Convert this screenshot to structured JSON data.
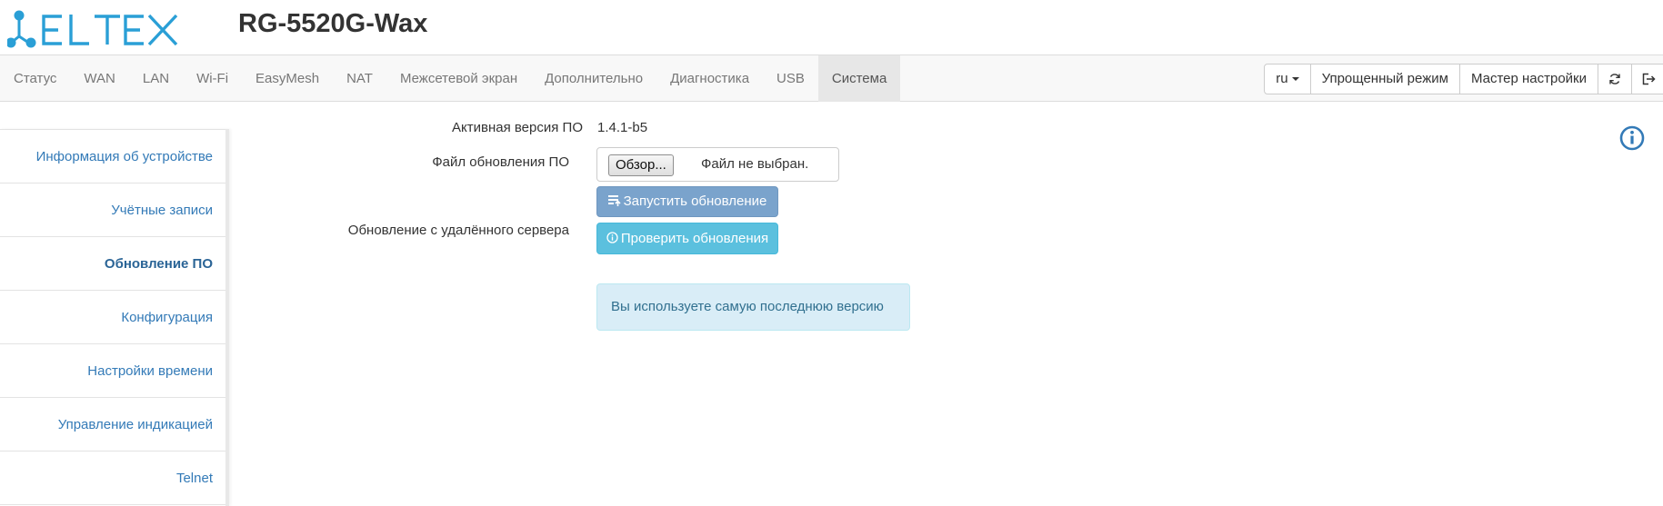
{
  "header": {
    "logo_text": "ELTEX",
    "device_title": "RG-5520G-Wax",
    "brand_color": "#2a9fd6"
  },
  "nav": {
    "tabs": [
      {
        "label": "Статус",
        "active": false
      },
      {
        "label": "WAN",
        "active": false
      },
      {
        "label": "LAN",
        "active": false
      },
      {
        "label": "Wi-Fi",
        "active": false
      },
      {
        "label": "EasyMesh",
        "active": false
      },
      {
        "label": "NAT",
        "active": false
      },
      {
        "label": "Межсетевой экран",
        "active": false
      },
      {
        "label": "Дополнительно",
        "active": false
      },
      {
        "label": "Диагностика",
        "active": false
      },
      {
        "label": "USB",
        "active": false
      },
      {
        "label": "Система",
        "active": true
      }
    ],
    "language": "ru",
    "simple_mode_label": "Упрощенный режим",
    "wizard_label": "Мастер настройки",
    "refresh_icon": "refresh-icon",
    "logout_icon": "logout-icon"
  },
  "sidebar": {
    "items": [
      {
        "label": "Информация об устройстве",
        "active": false
      },
      {
        "label": "Учётные записи",
        "active": false
      },
      {
        "label": "Обновление ПО",
        "active": true
      },
      {
        "label": "Конфигурация",
        "active": false
      },
      {
        "label": "Настройки времени",
        "active": false
      },
      {
        "label": "Управление индикацией",
        "active": false
      },
      {
        "label": "Telnet",
        "active": false
      }
    ]
  },
  "firmware": {
    "active_version_label": "Активная версия ПО",
    "active_version_value": "1.4.1-b5",
    "update_file_label": "Файл обновления ПО",
    "browse_label": "Обзор...",
    "file_status": "Файл не выбран.",
    "start_update_label": "Запустить обновление",
    "remote_update_label": "Обновление с удалённого сервера",
    "check_updates_label": "Проверить обновления",
    "latest_version_message": "Вы используете самую последнюю версию"
  },
  "colors": {
    "link": "#337ab7",
    "update_button": "#7aa3cc",
    "check_button": "#5bc0de",
    "alert_bg": "#d9edf7",
    "alert_text": "#31708f"
  }
}
